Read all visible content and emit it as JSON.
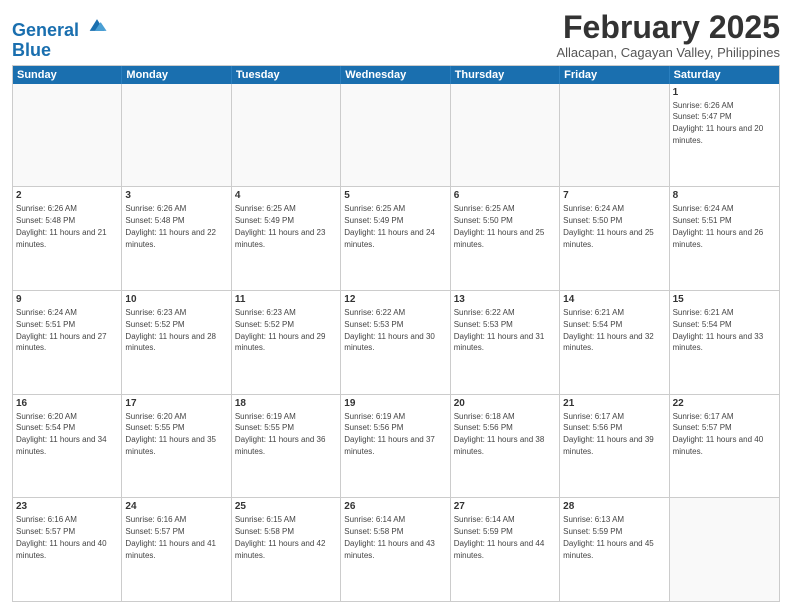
{
  "logo": {
    "line1": "General",
    "line2": "Blue"
  },
  "title": "February 2025",
  "subtitle": "Allacapan, Cagayan Valley, Philippines",
  "weekdays": [
    "Sunday",
    "Monday",
    "Tuesday",
    "Wednesday",
    "Thursday",
    "Friday",
    "Saturday"
  ],
  "weeks": [
    [
      {
        "day": "",
        "info": ""
      },
      {
        "day": "",
        "info": ""
      },
      {
        "day": "",
        "info": ""
      },
      {
        "day": "",
        "info": ""
      },
      {
        "day": "",
        "info": ""
      },
      {
        "day": "",
        "info": ""
      },
      {
        "day": "1",
        "info": "Sunrise: 6:26 AM\nSunset: 5:47 PM\nDaylight: 11 hours and 20 minutes."
      }
    ],
    [
      {
        "day": "2",
        "info": "Sunrise: 6:26 AM\nSunset: 5:48 PM\nDaylight: 11 hours and 21 minutes."
      },
      {
        "day": "3",
        "info": "Sunrise: 6:26 AM\nSunset: 5:48 PM\nDaylight: 11 hours and 22 minutes."
      },
      {
        "day": "4",
        "info": "Sunrise: 6:25 AM\nSunset: 5:49 PM\nDaylight: 11 hours and 23 minutes."
      },
      {
        "day": "5",
        "info": "Sunrise: 6:25 AM\nSunset: 5:49 PM\nDaylight: 11 hours and 24 minutes."
      },
      {
        "day": "6",
        "info": "Sunrise: 6:25 AM\nSunset: 5:50 PM\nDaylight: 11 hours and 25 minutes."
      },
      {
        "day": "7",
        "info": "Sunrise: 6:24 AM\nSunset: 5:50 PM\nDaylight: 11 hours and 25 minutes."
      },
      {
        "day": "8",
        "info": "Sunrise: 6:24 AM\nSunset: 5:51 PM\nDaylight: 11 hours and 26 minutes."
      }
    ],
    [
      {
        "day": "9",
        "info": "Sunrise: 6:24 AM\nSunset: 5:51 PM\nDaylight: 11 hours and 27 minutes."
      },
      {
        "day": "10",
        "info": "Sunrise: 6:23 AM\nSunset: 5:52 PM\nDaylight: 11 hours and 28 minutes."
      },
      {
        "day": "11",
        "info": "Sunrise: 6:23 AM\nSunset: 5:52 PM\nDaylight: 11 hours and 29 minutes."
      },
      {
        "day": "12",
        "info": "Sunrise: 6:22 AM\nSunset: 5:53 PM\nDaylight: 11 hours and 30 minutes."
      },
      {
        "day": "13",
        "info": "Sunrise: 6:22 AM\nSunset: 5:53 PM\nDaylight: 11 hours and 31 minutes."
      },
      {
        "day": "14",
        "info": "Sunrise: 6:21 AM\nSunset: 5:54 PM\nDaylight: 11 hours and 32 minutes."
      },
      {
        "day": "15",
        "info": "Sunrise: 6:21 AM\nSunset: 5:54 PM\nDaylight: 11 hours and 33 minutes."
      }
    ],
    [
      {
        "day": "16",
        "info": "Sunrise: 6:20 AM\nSunset: 5:54 PM\nDaylight: 11 hours and 34 minutes."
      },
      {
        "day": "17",
        "info": "Sunrise: 6:20 AM\nSunset: 5:55 PM\nDaylight: 11 hours and 35 minutes."
      },
      {
        "day": "18",
        "info": "Sunrise: 6:19 AM\nSunset: 5:55 PM\nDaylight: 11 hours and 36 minutes."
      },
      {
        "day": "19",
        "info": "Sunrise: 6:19 AM\nSunset: 5:56 PM\nDaylight: 11 hours and 37 minutes."
      },
      {
        "day": "20",
        "info": "Sunrise: 6:18 AM\nSunset: 5:56 PM\nDaylight: 11 hours and 38 minutes."
      },
      {
        "day": "21",
        "info": "Sunrise: 6:17 AM\nSunset: 5:56 PM\nDaylight: 11 hours and 39 minutes."
      },
      {
        "day": "22",
        "info": "Sunrise: 6:17 AM\nSunset: 5:57 PM\nDaylight: 11 hours and 40 minutes."
      }
    ],
    [
      {
        "day": "23",
        "info": "Sunrise: 6:16 AM\nSunset: 5:57 PM\nDaylight: 11 hours and 40 minutes."
      },
      {
        "day": "24",
        "info": "Sunrise: 6:16 AM\nSunset: 5:57 PM\nDaylight: 11 hours and 41 minutes."
      },
      {
        "day": "25",
        "info": "Sunrise: 6:15 AM\nSunset: 5:58 PM\nDaylight: 11 hours and 42 minutes."
      },
      {
        "day": "26",
        "info": "Sunrise: 6:14 AM\nSunset: 5:58 PM\nDaylight: 11 hours and 43 minutes."
      },
      {
        "day": "27",
        "info": "Sunrise: 6:14 AM\nSunset: 5:59 PM\nDaylight: 11 hours and 44 minutes."
      },
      {
        "day": "28",
        "info": "Sunrise: 6:13 AM\nSunset: 5:59 PM\nDaylight: 11 hours and 45 minutes."
      },
      {
        "day": "",
        "info": ""
      }
    ]
  ]
}
